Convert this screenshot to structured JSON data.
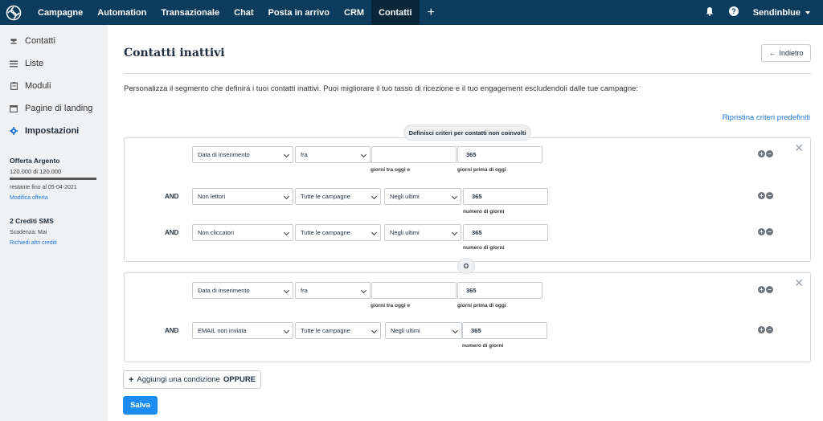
{
  "topnav": {
    "items": [
      "Campagne",
      "Automation",
      "Transazionale",
      "Chat",
      "Posta in arrivo",
      "CRM",
      "Contatti"
    ],
    "active_index": 6,
    "account": "Sendinblue"
  },
  "sidebar": {
    "items": [
      "Contatti",
      "Liste",
      "Moduli",
      "Pagine di landing",
      "Impostazioni"
    ],
    "active_index": 4,
    "plan": {
      "title": "Offerta Argento",
      "usage": "120.000 di 120.000",
      "progress": 1.0,
      "remaining": "restante fino al 05-04-2021",
      "modify_link": "Modifica offerta"
    },
    "sms": {
      "title": "2 Crediti SMS",
      "expiry": "Scadenza: Mai",
      "request_link": "Richiedi altri crediti"
    }
  },
  "main": {
    "title": "Contatti inattivi",
    "back_label": "Indietro",
    "description": "Personalizza il segmento che definirá i tuoi contatti inattivi. Puoi migliorare il tuo tasso di ricezione e il tuo engagement escludendoli dalle tue campagne:",
    "reset_link": "Ripristina criteri predefiniti",
    "criteria_header": "Definisci criteri per contatti non coinvolti",
    "or_label": "O",
    "and_label": "AND",
    "group1": {
      "row1": {
        "field": "Data di inserimento",
        "operator": "fra",
        "value1": "",
        "value2": "365",
        "hint1": "giorni tra oggi e",
        "hint2": "giorni prima di oggi"
      },
      "row2": {
        "field": "Non lettori",
        "campaign": "Tutte le campagne",
        "period": "Negli ultimi",
        "value": "365",
        "hint": "numero di giorni"
      },
      "row3": {
        "field": "Non cliccatori",
        "campaign": "Tutte le campagne",
        "period": "Negli ultimi",
        "value": "365",
        "hint": "numero di giorni"
      }
    },
    "group2": {
      "row1": {
        "field": "Data di inserimento",
        "operator": "fra",
        "value1": "",
        "value2": "365",
        "hint1": "giorni tra oggi e",
        "hint2": "giorni prima di oggi"
      },
      "row2": {
        "field": "EMAIL non inviata",
        "campaign": "Tutte le campagne",
        "period": "Negli ultimi",
        "value": "365",
        "hint": "numero di giorni"
      }
    },
    "add_condition_label": "Aggiungi una condizione",
    "add_condition_bold": "OPPURE",
    "save_label": "Salva"
  }
}
